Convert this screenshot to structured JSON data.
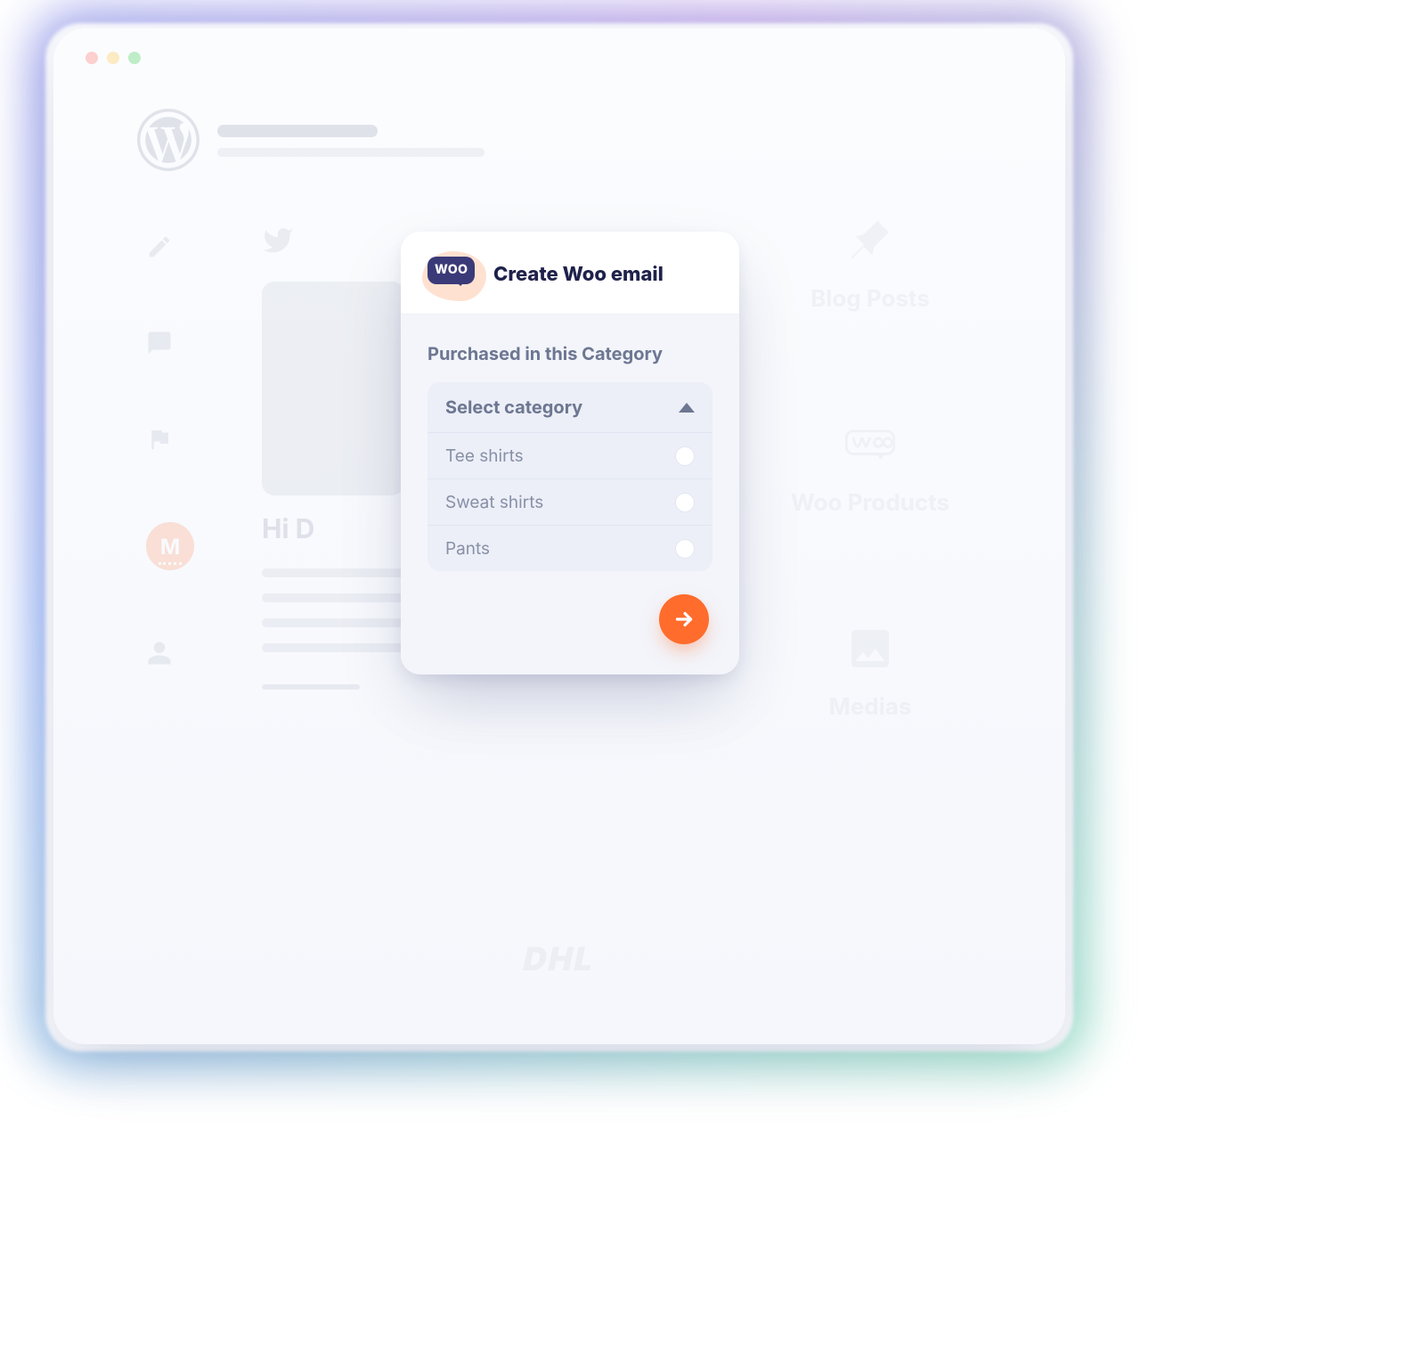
{
  "modal": {
    "badge_text": "WOO",
    "title": "Create Woo email",
    "section_label": "Purchased in this Category",
    "dropdown": {
      "placeholder": "Select category",
      "options": [
        "Tee shirts",
        "Sweat shirts",
        "Pants"
      ]
    }
  },
  "backdrop": {
    "greeting_prefix": "Hi D",
    "right_items": [
      "Blog Posts",
      "Woo Products",
      "Medias"
    ],
    "footer_brand": "DHL",
    "avatar_letter": "M"
  },
  "colors": {
    "accent": "#ff6c2c",
    "woo_purple": "#3a3a78",
    "heading": "#6d7792"
  }
}
